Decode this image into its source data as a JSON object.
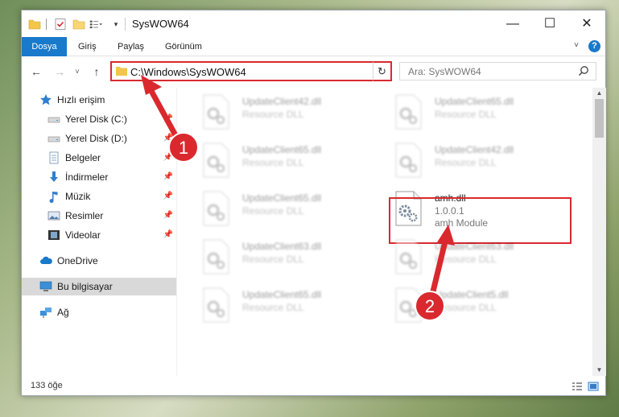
{
  "window": {
    "title": "SysWOW64",
    "minimize_glyph": "—",
    "maximize_glyph": "☐",
    "close_glyph": "✕"
  },
  "ribbon": {
    "tabs": [
      {
        "label": "Dosya",
        "active": true
      },
      {
        "label": "Giriş"
      },
      {
        "label": "Paylaş"
      },
      {
        "label": "Görünüm"
      }
    ],
    "help_glyph": "?"
  },
  "navigation": {
    "back_glyph": "←",
    "forward_glyph": "→",
    "recent_glyph": "˅",
    "up_glyph": "↑"
  },
  "address_bar": {
    "path": "C:\\Windows\\SysWOW64",
    "dropdown_glyph": "˅",
    "refresh_glyph": "↻"
  },
  "search": {
    "placeholder": "Ara: SysWOW64"
  },
  "sidebar": {
    "items": [
      {
        "label": "Hızlı erişim",
        "icon": "star-icon",
        "pinned": false
      },
      {
        "label": "Yerel Disk (C:)",
        "icon": "drive-icon",
        "pinned": true
      },
      {
        "label": "Yerel Disk (D:)",
        "icon": "drive-icon",
        "pinned": true
      },
      {
        "label": "Belgeler",
        "icon": "documents-icon",
        "pinned": true
      },
      {
        "label": "İndirmeler",
        "icon": "download-icon",
        "pinned": true
      },
      {
        "label": "Müzik",
        "icon": "music-icon",
        "pinned": true
      },
      {
        "label": "Resimler",
        "icon": "pictures-icon",
        "pinned": true
      },
      {
        "label": "Videolar",
        "icon": "video-icon",
        "pinned": true
      },
      {
        "label": "OneDrive",
        "icon": "cloud-icon",
        "pinned": false
      },
      {
        "label": "Bu bilgisayar",
        "icon": "computer-icon",
        "pinned": false,
        "selected": true
      },
      {
        "label": "Ağ",
        "icon": "network-icon",
        "pinned": false
      }
    ],
    "pin_glyph": "📌"
  },
  "files": [
    {
      "name": "UpdateClient42.dll",
      "type": "Resource DLL",
      "blurred": true
    },
    {
      "name": "UpdateClient65.dll",
      "type": "Resource DLL",
      "blurred": true
    },
    {
      "name": "UpdateClient65.dll",
      "type": "Resource DLL",
      "blurred": true
    },
    {
      "name": "UpdateClient42.dll",
      "type": "Resource DLL",
      "blurred": true
    },
    {
      "name": "UpdateClient65.dll",
      "type": "Resource DLL",
      "blurred": true
    },
    {
      "name": "amh.dll",
      "type": "1.0.0.1",
      "description": "amh Module",
      "blurred": false,
      "highlighted": true
    },
    {
      "name": "UpdateClient63.dll",
      "type": "Resource DLL",
      "blurred": true
    },
    {
      "name": "UpdateClient63.dll",
      "type": "Resource DLL",
      "blurred": true
    },
    {
      "name": "UpdateClient65.dll",
      "type": "Resource DLL",
      "blurred": true
    },
    {
      "name": "UpdateClient5.dll",
      "type": "Resource DLL",
      "blurred": true
    }
  ],
  "status": {
    "item_count": "133 öğe"
  },
  "annotations": {
    "step1": "1",
    "step2": "2",
    "color": "#d9292f"
  },
  "colors": {
    "accent": "#1979ca",
    "highlight": "#d9292f",
    "selected_bg": "#cde8ff"
  }
}
